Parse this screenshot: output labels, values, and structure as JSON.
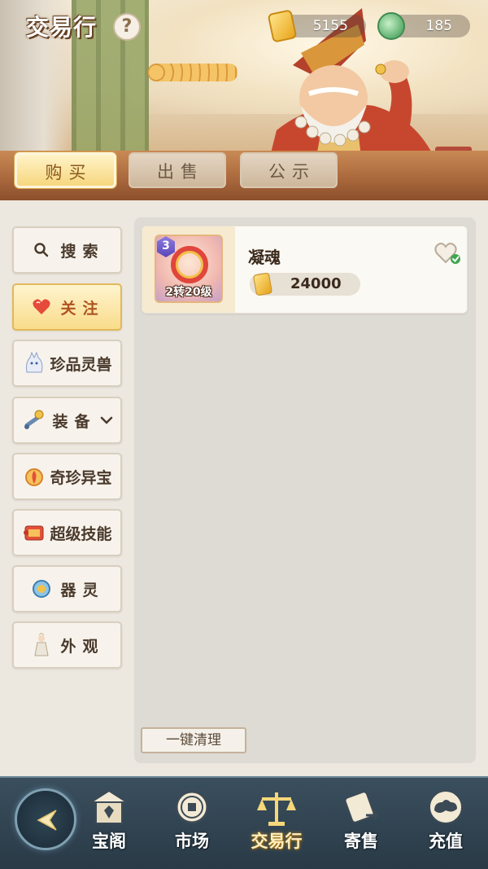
{
  "header": {
    "title": "交易行",
    "help_icon": "question-icon",
    "help_label": "?"
  },
  "currencies": {
    "gold": "5155",
    "jade": "185"
  },
  "tabs": [
    {
      "label": "购买",
      "active": true
    },
    {
      "label": "出售",
      "active": false
    },
    {
      "label": "公示",
      "active": false
    }
  ],
  "categories": [
    {
      "label": "搜索",
      "icon": "search-icon",
      "selected": false
    },
    {
      "label": "关注",
      "icon": "heart-icon",
      "selected": true
    },
    {
      "label": "珍品灵兽",
      "icon": "spirit-beast-icon",
      "selected": false
    },
    {
      "label": "装备",
      "icon": "equipment-icon",
      "selected": false
    },
    {
      "label": "奇珍异宝",
      "icon": "treasure-icon",
      "selected": false
    },
    {
      "label": "超级技能",
      "icon": "skill-scroll-icon",
      "selected": false
    },
    {
      "label": "器灵",
      "icon": "artifact-spirit-icon",
      "selected": false
    },
    {
      "label": "外观",
      "icon": "appearance-icon",
      "selected": false
    }
  ],
  "items": [
    {
      "name": "凝魂",
      "rarity_badge": "3",
      "level_text": "2转20级",
      "price": "24000",
      "favorited": true
    }
  ],
  "clear_button": "一键清理",
  "bottom_nav": [
    {
      "label": "宝阁",
      "icon": "pavilion-icon",
      "active": false
    },
    {
      "label": "市场",
      "icon": "coin-icon",
      "active": false
    },
    {
      "label": "交易行",
      "icon": "scales-icon",
      "active": true
    },
    {
      "label": "寄售",
      "icon": "consign-icon",
      "active": false
    },
    {
      "label": "充值",
      "icon": "cloud-icon",
      "active": false
    }
  ]
}
